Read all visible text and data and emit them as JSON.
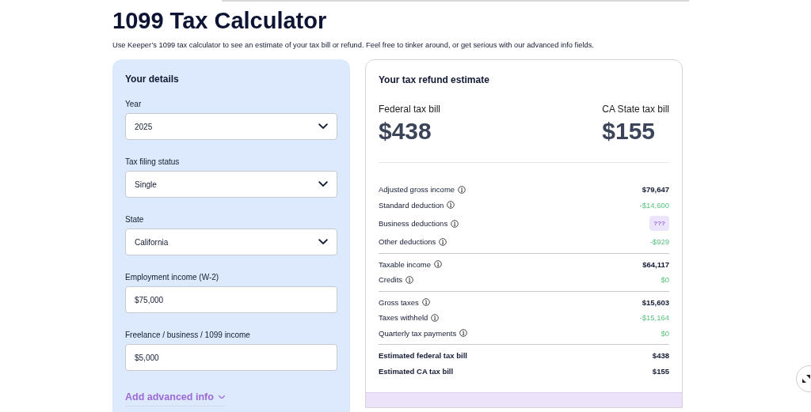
{
  "page": {
    "title": "1099 Tax Calculator",
    "intro": "Use Keeper’s 1099 tax calculator to see an estimate of your tax bill or refund. Feel free to tinker around, or get serious with our advanced info fields."
  },
  "details": {
    "heading": "Your details",
    "fields": [
      {
        "label": "Year",
        "value": "2025",
        "kind": "select"
      },
      {
        "label": "Tax filing status",
        "value": "Single",
        "kind": "select"
      },
      {
        "label": "State",
        "value": "California",
        "kind": "select"
      },
      {
        "label": "Employment income (W-2)",
        "value": "$75,000",
        "kind": "text"
      },
      {
        "label": "Freelance / business / 1099 income",
        "value": "$5,000",
        "kind": "text"
      }
    ],
    "advanced_link": "Add advanced info",
    "advanced_expanded": false
  },
  "estimate": {
    "heading": "Your tax refund estimate",
    "bills": [
      {
        "label": "Federal tax bill",
        "amount": "$438"
      },
      {
        "label": "CA State tax bill",
        "amount": "$155"
      }
    ],
    "groups": [
      [
        {
          "label": "Adjusted gross income",
          "value": "$79,647",
          "kind": "plain",
          "info": true
        },
        {
          "label": "Standard deduction",
          "value": "-$14,600",
          "kind": "credit",
          "info": true
        },
        {
          "label": "Business deductions",
          "value": "???",
          "kind": "unknown",
          "info": true
        },
        {
          "label": "Other deductions",
          "value": "-$929",
          "kind": "credit",
          "info": true
        }
      ],
      [
        {
          "label": "Taxable income",
          "value": "$64,117",
          "kind": "plain",
          "info": true
        },
        {
          "label": "Credits",
          "value": "$0",
          "kind": "credit",
          "info": true
        }
      ],
      [
        {
          "label": "Gross taxes",
          "value": "$15,603",
          "kind": "plain",
          "info": true
        },
        {
          "label": "Taxes withheld",
          "value": "-$15,164",
          "kind": "credit",
          "info": true
        },
        {
          "label": "Quarterly tax payments",
          "value": "$0",
          "kind": "credit",
          "info": true
        }
      ],
      [
        {
          "label": "Estimated federal tax bill",
          "value": "$438",
          "kind": "total",
          "info": false
        },
        {
          "label": "Estimated CA tax bill",
          "value": "$155",
          "kind": "total",
          "info": false
        }
      ]
    ]
  }
}
